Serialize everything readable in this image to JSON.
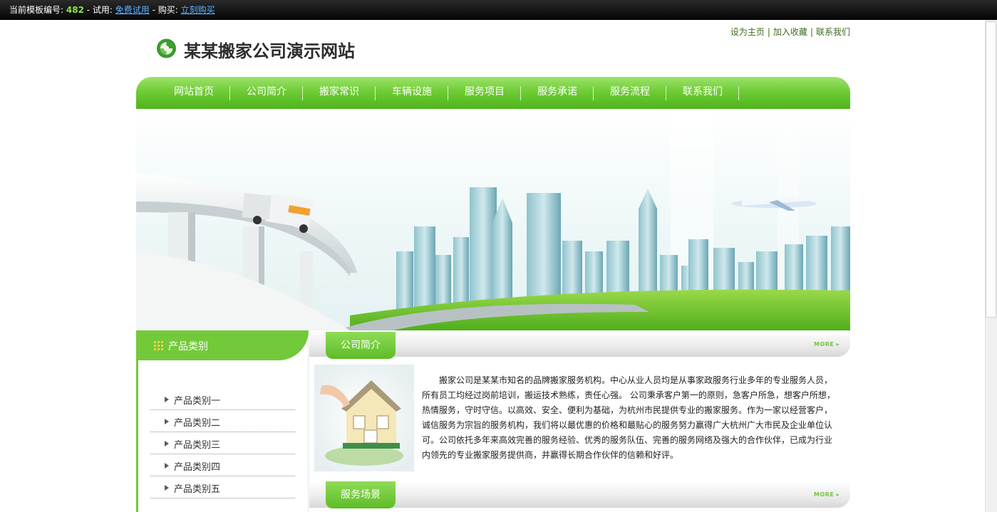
{
  "topbar": {
    "prefix": "当前模板编号:",
    "template_number": "482",
    "trial_prefix": "- 试用:",
    "trial_link": "免费试用",
    "buy_prefix": "- 购买:",
    "buy_link": "立刻购买"
  },
  "header": {
    "site_title": "某某搬家公司演示网站",
    "links": [
      "设为主页",
      "加入收藏",
      "联系我们"
    ],
    "separator": "|"
  },
  "nav": {
    "items": [
      "网站首页",
      "公司简介",
      "搬家常识",
      "车辆设施",
      "服务项目",
      "服务承诺",
      "服务流程",
      "联系我们"
    ]
  },
  "sidebar": {
    "title": "产品类别",
    "items": [
      "产品类别一",
      "产品类别二",
      "产品类别三",
      "产品类别四",
      "产品类别五"
    ]
  },
  "about": {
    "title": "公司简介",
    "more": "MORE",
    "text": "搬家公司是某某市知名的品牌搬家服务机构。中心从业人员均是从事家政服务行业多年的专业服务人员，所有员工均经过岗前培训，搬运技术熟练，责任心强。 公司秉承客户第一的原则，急客户所急，想客户所想，热情服务，守时守信。以高效、安全、便利为基础，为杭州市民提供专业的搬家服务。作为一家以经营客户，诚信服务为宗旨的服务机构，我们将以最优惠的价格和最贴心的服务努力赢得广大杭州广大市民及企业单位认可。公司依托多年来高效完善的服务经验、优秀的服务队伍、完善的服务网络及强大的合作伙伴，已成为行业内领先的专业搬家服务提供商，并赢得长期合作伙伴的信赖和好评。"
  },
  "scenes": {
    "title": "服务场景",
    "more": "MORE"
  },
  "colors": {
    "accent_green": "#72c93a",
    "topbar_bg": "#111111",
    "highlight_number": "#8de24a",
    "link_blue": "#5ab4ff"
  }
}
